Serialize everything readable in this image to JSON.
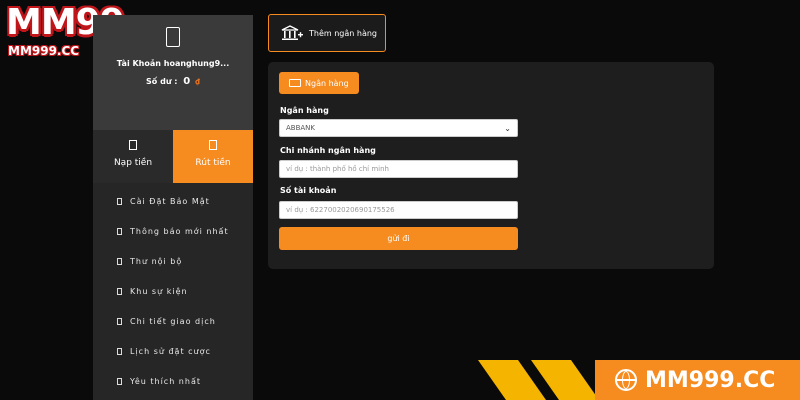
{
  "logo": {
    "main": "MM99",
    "sub": "MM999.CC"
  },
  "profile": {
    "account_label": "Tài Khoản hoanghung9...",
    "balance_label": "Số dư :",
    "balance_value": "0",
    "balance_currency": "₫"
  },
  "tabs": [
    {
      "label": "Nạp tiền",
      "active": false
    },
    {
      "label": "Rút tiền",
      "active": true
    }
  ],
  "menu": [
    {
      "label": "Cài Đặt Bảo Mật"
    },
    {
      "label": "Thông báo mới nhất"
    },
    {
      "label": "Thư nội bộ"
    },
    {
      "label": "Khu sự kiện"
    },
    {
      "label": "Chi tiết giao dịch"
    },
    {
      "label": "Lịch sử đặt cược"
    },
    {
      "label": "Yêu thích nhất"
    }
  ],
  "add_bank": {
    "label": "Thêm ngân hàng",
    "icon": "bank-plus-icon"
  },
  "form": {
    "tab_label": "Ngân hàng",
    "bank": {
      "label": "Ngân hàng",
      "value": "ABBANK"
    },
    "branch": {
      "label": "Chi nhánh ngân hàng",
      "placeholder": "ví dụ : thành phố hồ chí minh"
    },
    "account": {
      "label": "Số tài khoản",
      "placeholder": "ví dụ : 6227002020690175526"
    },
    "submit_label": "gửi đi"
  },
  "brand": {
    "label": "MM999.CC",
    "icon": "globe-icon"
  },
  "colors": {
    "accent": "#f68b1f",
    "sidebar": "#262626",
    "panel": "#1e1e1e",
    "stripe": "#f5b400"
  }
}
